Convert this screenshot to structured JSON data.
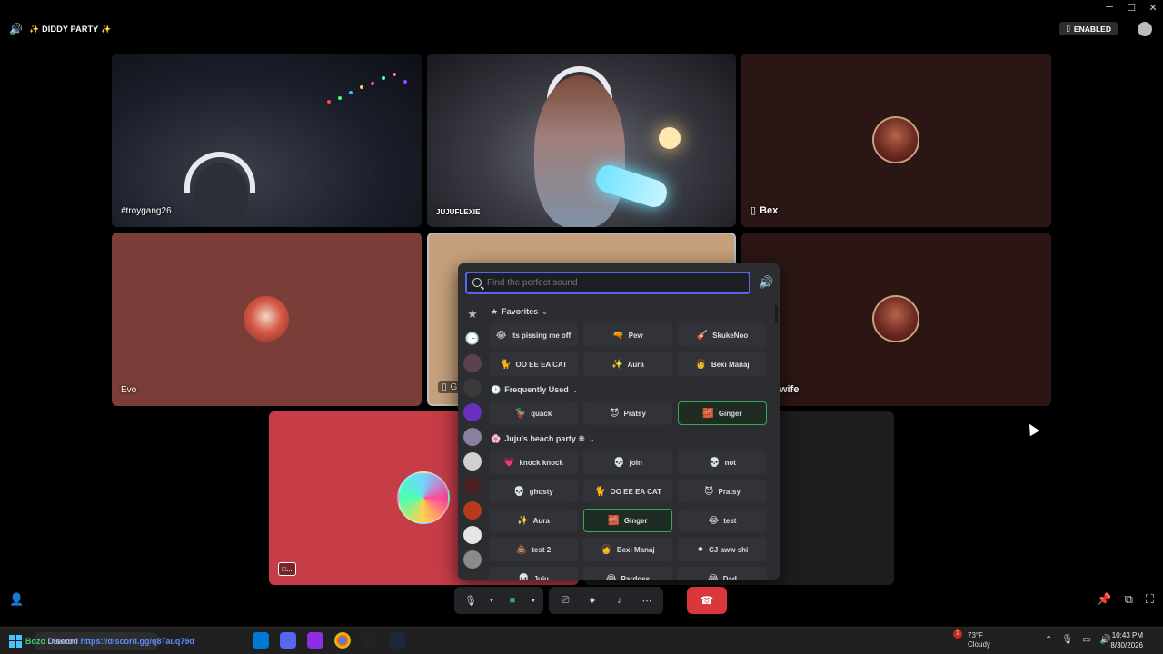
{
  "window": {
    "controls": [
      "─",
      "☐",
      "✕"
    ]
  },
  "call": {
    "channel_title": "✨ DIDDY PARTY ✨",
    "enabled_label": "ENABLED"
  },
  "participants": [
    {
      "name": "#troygang26"
    },
    {
      "name": "JUJUFLEXIE"
    },
    {
      "name": "Bex"
    },
    {
      "name": "Evo"
    },
    {
      "name": "G"
    },
    {
      "name": "wife"
    },
    {
      "name": "□..."
    }
  ],
  "soundboard": {
    "search_placeholder": "Find the perfect sound",
    "categories": [
      {
        "title": "Favorites",
        "icon": "★",
        "rows": [
          [
            {
              "emoji": "😂",
              "label": "Its pissing me off"
            },
            {
              "emoji": "🔫",
              "label": "Pew"
            },
            {
              "emoji": "🎸",
              "label": "SkukeNoo"
            }
          ],
          [
            {
              "emoji": "🐈",
              "label": "OO EE EA CAT"
            },
            {
              "emoji": "✨",
              "label": "Aura"
            },
            {
              "emoji": "👩",
              "label": "Bexi Manaj"
            }
          ]
        ]
      },
      {
        "title": "Frequently Used",
        "icon": "🕒",
        "rows": [
          [
            {
              "emoji": "🦆",
              "label": "quack"
            },
            {
              "emoji": "😈",
              "label": "Pratsy"
            },
            {
              "emoji": "🧱",
              "label": "Ginger",
              "active": true
            }
          ]
        ]
      },
      {
        "title": "Juju's beach party ❋",
        "icon": "🌸",
        "rows": [
          [
            {
              "emoji": "💗",
              "label": "knock knock"
            },
            {
              "emoji": "💀",
              "label": "join"
            },
            {
              "emoji": "💀",
              "label": "not"
            }
          ],
          [
            {
              "emoji": "💀",
              "label": "ghosty"
            },
            {
              "emoji": "🐈",
              "label": "OO EE EA CAT"
            },
            {
              "emoji": "😈",
              "label": "Pratsy"
            }
          ],
          [
            {
              "emoji": "✨",
              "label": "Aura"
            },
            {
              "emoji": "🧱",
              "label": "Ginger",
              "active": true
            },
            {
              "emoji": "😂",
              "label": "test"
            }
          ],
          [
            {
              "emoji": "💩",
              "label": "test 2"
            },
            {
              "emoji": "👩",
              "label": "Bexi Manaj"
            },
            {
              "emoji": "⚫",
              "label": "CJ aww shi"
            }
          ],
          [
            {
              "emoji": "💀",
              "label": "Juju"
            },
            {
              "emoji": "😂",
              "label": "Pardoss"
            },
            {
              "emoji": "😂",
              "label": "Dad"
            }
          ]
        ]
      }
    ]
  },
  "taskbar": {
    "search_placeholder": "Search",
    "overlay_text_a": "Bozo",
    "overlay_text_b": "Discord",
    "overlay_text_c": "https://discord.gg/q8Tauq79d",
    "weather_temp": "73°F",
    "weather_desc": "Cloudy",
    "notification_count": "1",
    "time": "10:43 PM",
    "date": "8/30/2026"
  }
}
